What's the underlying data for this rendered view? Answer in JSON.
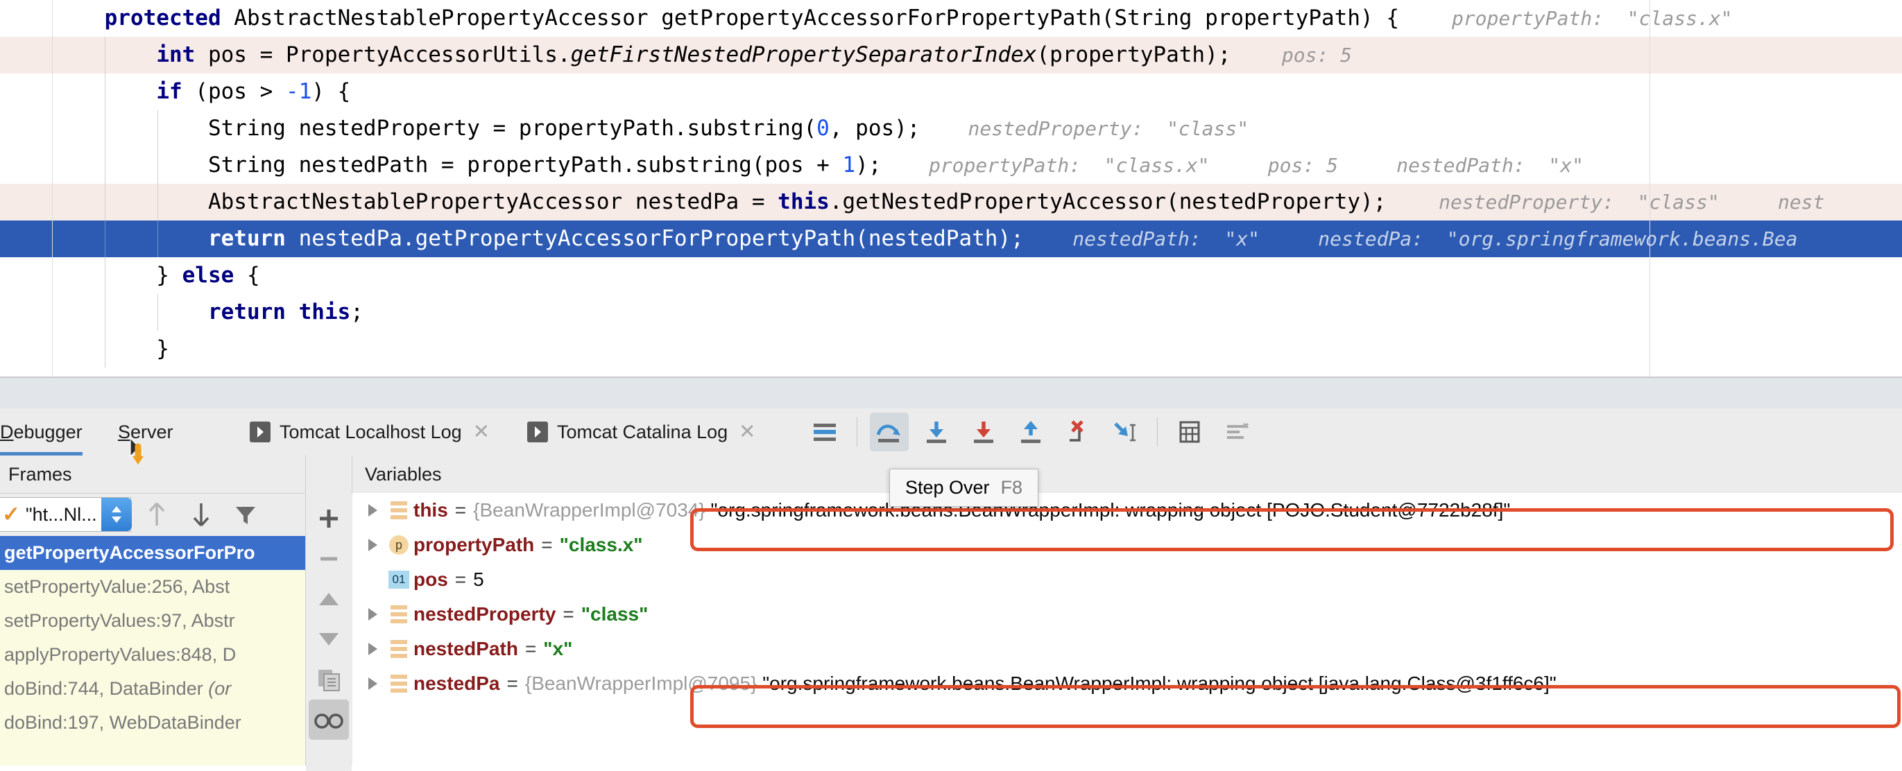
{
  "editor": {
    "lines": [
      {
        "indent": 4,
        "tokens": [
          {
            "t": "protected ",
            "c": "kw"
          },
          {
            "t": "AbstractNestablePropertyAccessor getPropertyAccessorForPropertyPath(",
            "c": "plain"
          },
          {
            "t": "String",
            "c": "plain"
          },
          {
            "t": " propertyPath) {",
            "c": "plain"
          }
        ],
        "text": "protected AbstractNestablePropertyAccessor getPropertyAccessorForPropertyPath(String propertyPath) {",
        "inlay": "propertyPath:  \"class.x\"",
        "state": "normal"
      },
      {
        "indent": 8,
        "text": "int pos = PropertyAccessorUtils.getFirstNestedPropertySeparatorIndex(propertyPath);",
        "inlay": "pos: 5",
        "state": "exec-prev"
      },
      {
        "indent": 8,
        "text": "if (pos > -1) {",
        "inlay": "",
        "state": "normal"
      },
      {
        "indent": 12,
        "text": "String nestedProperty = propertyPath.substring(0, pos);",
        "inlay": "nestedProperty:  \"class\"",
        "state": "normal"
      },
      {
        "indent": 12,
        "text": "String nestedPath = propertyPath.substring(pos + 1);",
        "inlay": "propertyPath:  \"class.x\"     pos: 5     nestedPath:  \"x\"",
        "state": "normal"
      },
      {
        "indent": 12,
        "text": "AbstractNestablePropertyAccessor nestedPa = this.getNestedPropertyAccessor(nestedProperty);",
        "inlay": "nestedProperty:  \"class\"     nest",
        "state": "exec-prev"
      },
      {
        "indent": 12,
        "text": "return nestedPa.getPropertyAccessorForPropertyPath(nestedPath);",
        "inlay": "nestedPath:  \"x\"     nestedPa:  \"org.springframework.beans.Bea",
        "state": "exec-cur"
      },
      {
        "indent": 8,
        "text": "} else {",
        "inlay": "",
        "state": "normal"
      },
      {
        "indent": 12,
        "text": "return this;",
        "inlay": "",
        "state": "normal"
      },
      {
        "indent": 8,
        "text": "}",
        "inlay": "",
        "state": "normal"
      }
    ]
  },
  "toolwindow": {
    "tabs": [
      {
        "label": "Debugger",
        "mnemonic": "D",
        "selected": true,
        "has_run_icon": false,
        "closable": false
      },
      {
        "label": "Server",
        "mnemonic": "S",
        "selected": false,
        "has_run_icon": false,
        "closable": false
      },
      {
        "label": "Tomcat Localhost Log",
        "mnemonic": "",
        "selected": false,
        "has_run_icon": true,
        "closable": true
      },
      {
        "label": "Tomcat Catalina Log",
        "mnemonic": "",
        "selected": false,
        "has_run_icon": true,
        "closable": true
      }
    ],
    "toolbar": [
      {
        "name": "show-execution-point-icon",
        "title": "Show Execution Point",
        "active": false
      },
      {
        "name": "step-over-icon",
        "title": "Step Over",
        "active": true
      },
      {
        "name": "step-into-icon",
        "title": "Step Into",
        "active": false
      },
      {
        "name": "force-step-into-icon",
        "title": "Force Step Into",
        "active": false
      },
      {
        "name": "step-out-icon",
        "title": "Step Out",
        "active": false
      },
      {
        "name": "drop-frame-icon",
        "title": "Drop Frame",
        "active": false
      },
      {
        "name": "run-to-cursor-icon",
        "title": "Run to Cursor",
        "active": false
      },
      {
        "name": "evaluate-expression-icon",
        "title": "Evaluate Expression",
        "active": false
      },
      {
        "name": "settings-icon",
        "title": "Settings",
        "active": false
      }
    ],
    "tooltip": {
      "label": "Step Over",
      "shortcut": "F8"
    },
    "frames_panel": {
      "title": "Frames",
      "thread_selector": {
        "value": "\"ht...Nl...",
        "checkmark": "✓"
      },
      "buttons": [
        "up-arrow",
        "down-arrow",
        "filter"
      ],
      "frames": [
        {
          "label": "getPropertyAccessorForPro",
          "selected": true
        },
        {
          "label": "setPropertyValue:256, Abst",
          "selected": false
        },
        {
          "label": "setPropertyValues:97, Abstr",
          "selected": false
        },
        {
          "label": "applyPropertyValues:848, D",
          "selected": false
        },
        {
          "label": "doBind:744, DataBinder (or",
          "selected": false
        },
        {
          "label": "doBind:197, WebDataBinder",
          "selected": false
        }
      ]
    },
    "side_toolbar": [
      {
        "name": "add-watch-button",
        "glyph": "+"
      },
      {
        "name": "remove-watch-button",
        "glyph": "−"
      },
      {
        "name": "move-up-button",
        "glyph": "▲"
      },
      {
        "name": "move-down-button",
        "glyph": "▼"
      },
      {
        "name": "copy-value-button",
        "glyph": "copy"
      },
      {
        "name": "watches-toggle-button",
        "glyph": "glasses"
      }
    ],
    "variables_panel": {
      "title": "Variables",
      "rows": [
        {
          "expandable": true,
          "icon": "object",
          "name": "this",
          "type": "{BeanWrapperImpl@7034}",
          "value": "\"org.springframework.beans.BeanWrapperImpl: wrapping object [POJO.Student@7722b28f]\"",
          "value_style": "plain",
          "annotated": true
        },
        {
          "expandable": true,
          "icon": "param",
          "icon_text": "p",
          "name": "propertyPath",
          "type": "",
          "value": "\"class.x\"",
          "value_style": "string",
          "annotated": false
        },
        {
          "expandable": false,
          "icon": "primitive",
          "icon_text": "01",
          "name": "pos",
          "type": "",
          "value": "5",
          "value_style": "number",
          "annotated": false
        },
        {
          "expandable": true,
          "icon": "object",
          "name": "nestedProperty",
          "type": "",
          "value": "\"class\"",
          "value_style": "string",
          "annotated": false
        },
        {
          "expandable": true,
          "icon": "object",
          "name": "nestedPath",
          "type": "",
          "value": "\"x\"",
          "value_style": "string",
          "annotated": false
        },
        {
          "expandable": true,
          "icon": "object",
          "name": "nestedPa",
          "type": "{BeanWrapperImpl@7095}",
          "value": "\"org.springframework.beans.BeanWrapperImpl: wrapping object [java.lang.Class@3f1ff6c6]\"",
          "value_style": "plain",
          "annotated": true
        }
      ]
    }
  },
  "colors": {
    "exec_current_line": "#2d5bb3",
    "exec_prev_line": "#f7ebe8",
    "annotation": "#e04b2a",
    "frames_bg": "#fbfbe2",
    "selection": "#3b6fcc",
    "var_name": "#871b1b",
    "var_string": "#1b7d1b",
    "var_type": "#9b9b9b"
  }
}
